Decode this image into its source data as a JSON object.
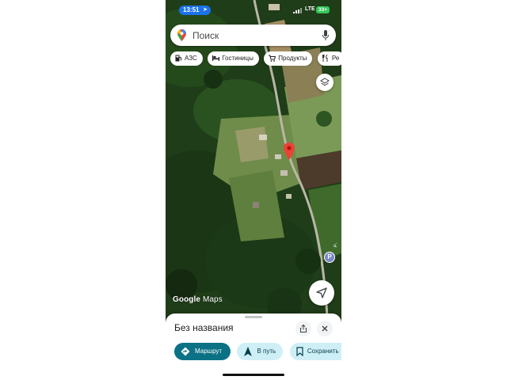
{
  "status_bar": {
    "time": "13:51",
    "network": "LTE",
    "battery": "33+"
  },
  "search": {
    "placeholder": "Поиск",
    "icons": [
      "maps-pin-icon",
      "mic-icon"
    ]
  },
  "chips": [
    {
      "label": "АЗС",
      "icon": "gas-station-icon"
    },
    {
      "label": "Гостиницы",
      "icon": "bed-icon"
    },
    {
      "label": "Продукты",
      "icon": "cart-icon"
    },
    {
      "label": "Ре",
      "icon": "restaurant-icon"
    }
  ],
  "map": {
    "logo": {
      "brand": "Google",
      "product": "Maps"
    },
    "parking_label": "P",
    "road_label": "Р-",
    "colors": {
      "marker": "#ea4335",
      "field": "#6f8c4a",
      "forest": "#1d3a16",
      "road": "#b9b6a6"
    }
  },
  "place_sheet": {
    "title": "Без названия",
    "actions": [
      {
        "label": "Маршрут",
        "icon": "directions-icon",
        "style": "primary"
      },
      {
        "label": "В путь",
        "icon": "navigation-arrow-icon",
        "style": "secondary"
      },
      {
        "label": "Сохранить",
        "icon": "bookmark-icon",
        "style": "secondary"
      }
    ]
  },
  "accent_color": "#0b7285"
}
